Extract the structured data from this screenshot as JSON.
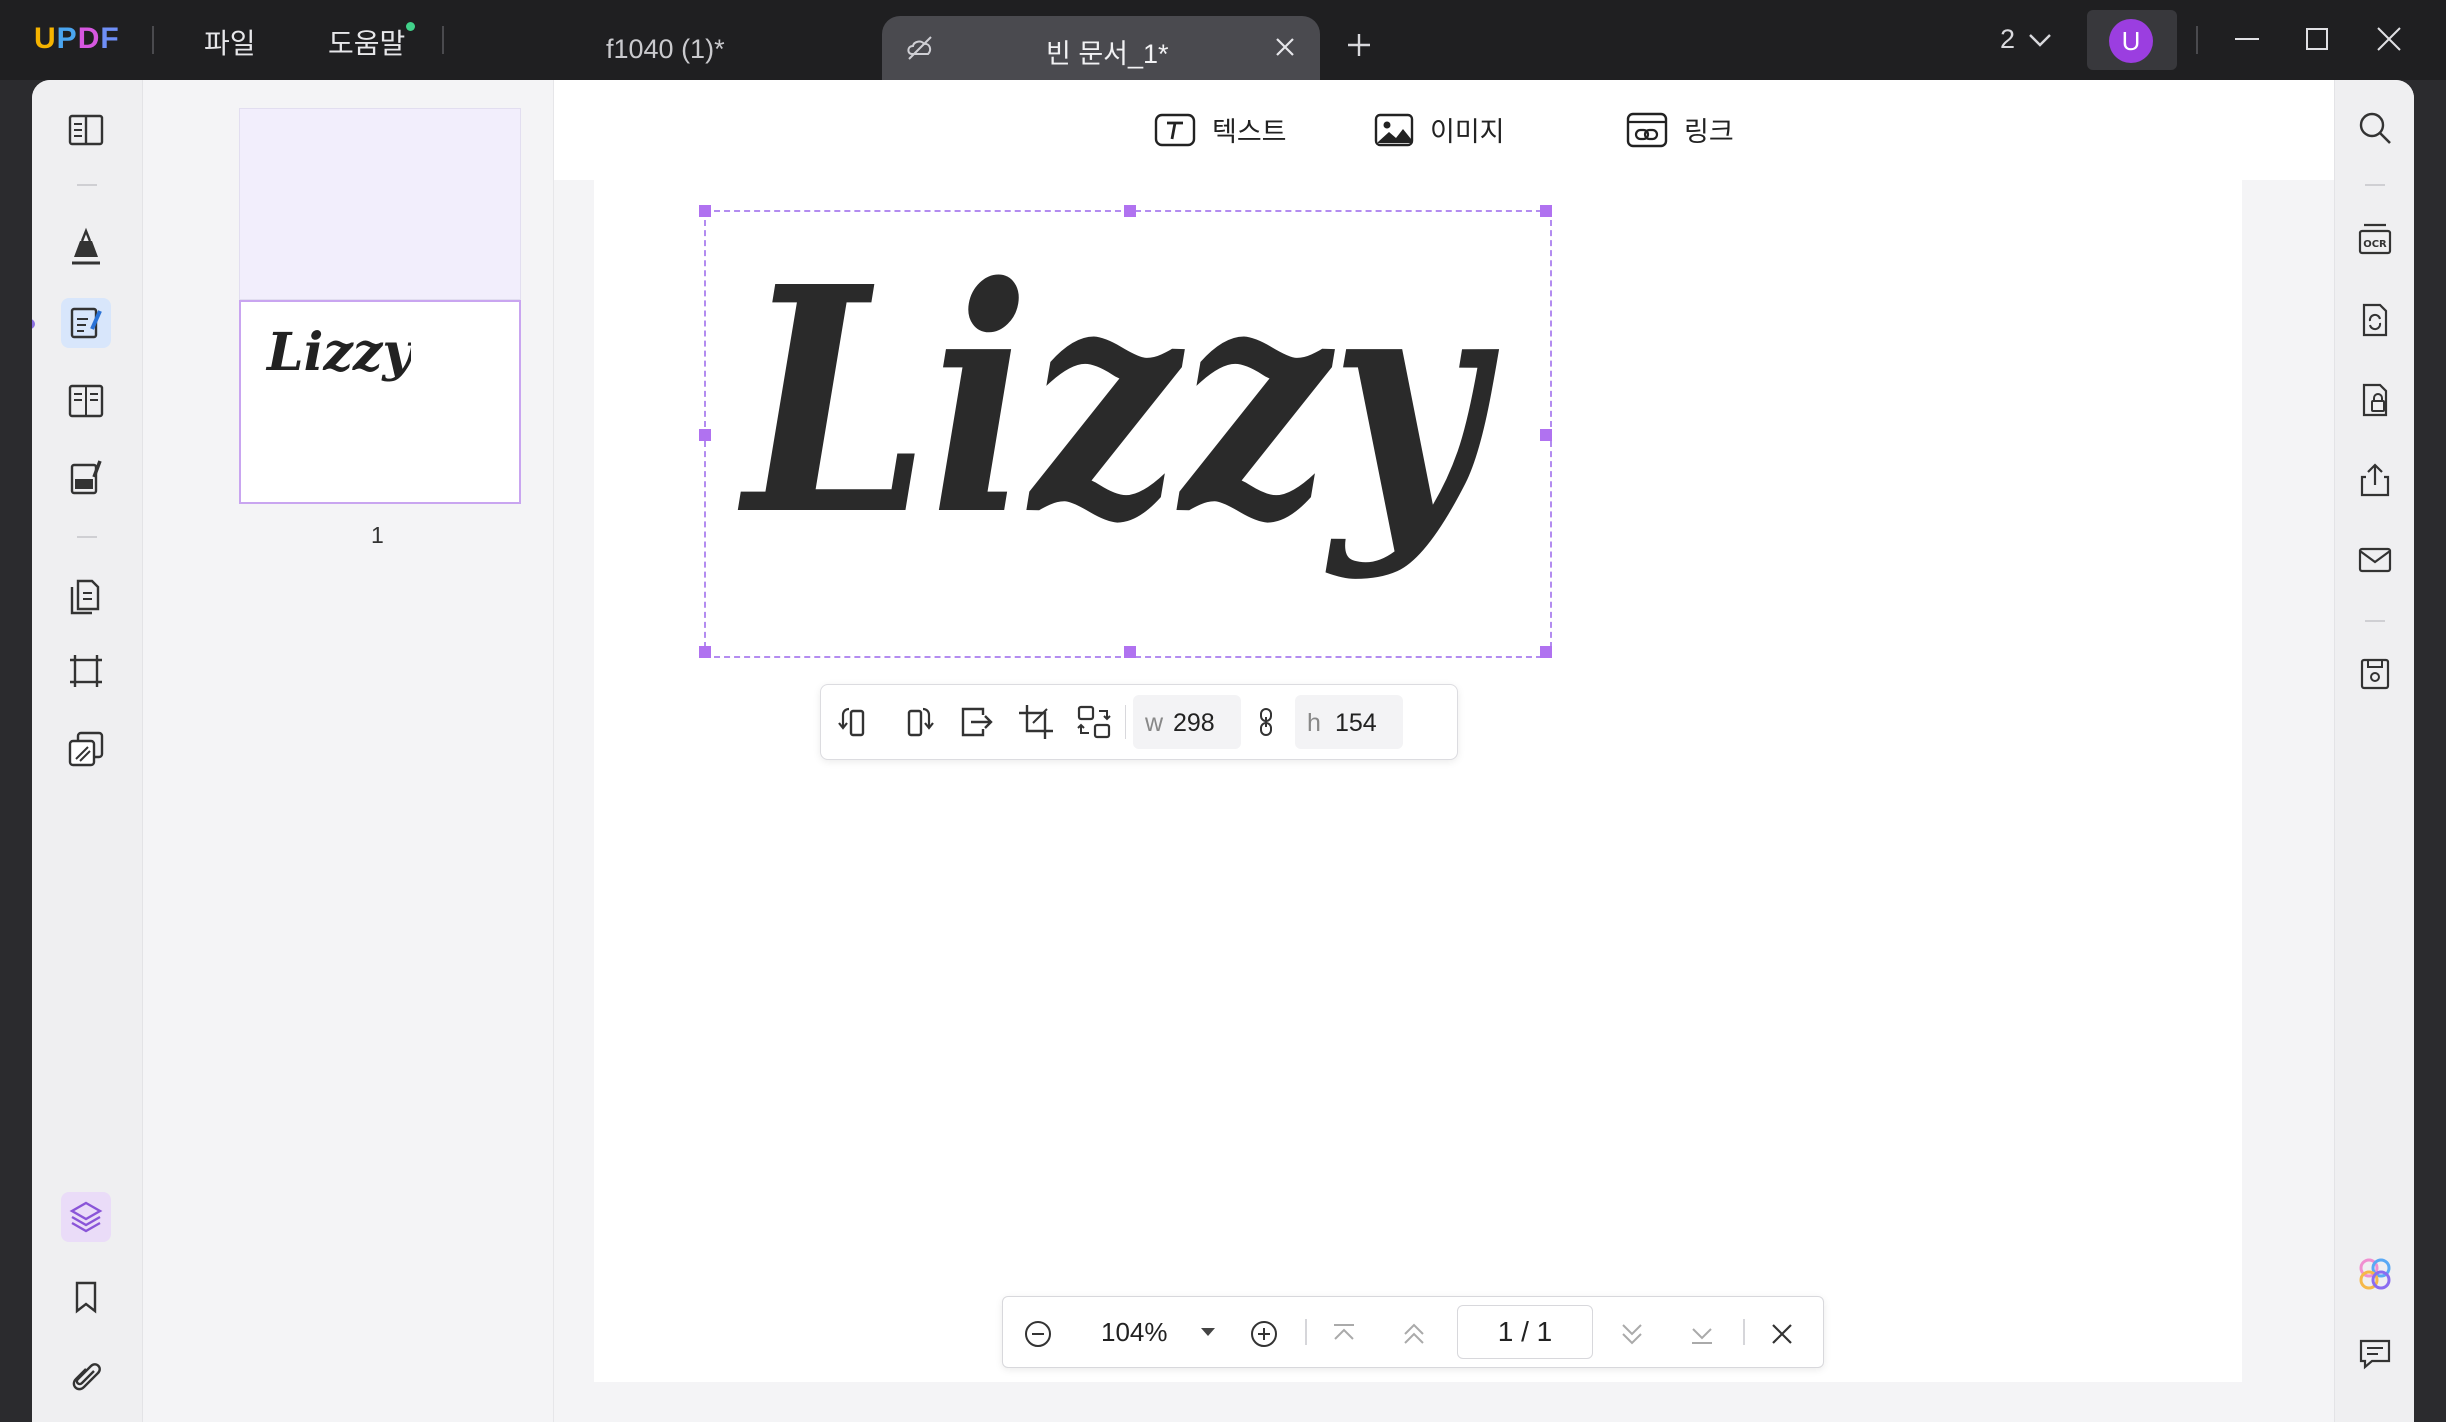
{
  "app": {
    "logo": "UPDF"
  },
  "menu": {
    "file": "파일",
    "help": "도움말"
  },
  "tabs": [
    {
      "label": "f1040 (1)*",
      "active": false
    },
    {
      "label": "빈 문서_1*",
      "active": true
    }
  ],
  "header": {
    "page_count": "2",
    "avatar_initial": "U"
  },
  "left_rail": {
    "items": [
      "reader-icon",
      "comment-icon",
      "edit-pdf-icon",
      "form-icon",
      "fill-sign-icon",
      "organize-icon",
      "crop-icon",
      "watermark-icon",
      "layers-icon",
      "bookmark-icon",
      "attachment-icon"
    ],
    "active": "edit-pdf-icon"
  },
  "thumbnails": {
    "page_number": "1",
    "preview_text": "Lizzy"
  },
  "edit_toolbar": {
    "text_label": "텍스트",
    "image_label": "이미지",
    "link_label": "링크"
  },
  "document": {
    "signature_text": "Lizzy"
  },
  "image_toolbar": {
    "width_label": "w",
    "width_value": "298",
    "height_label": "h",
    "height_value": "154"
  },
  "page_nav": {
    "zoom": "104%",
    "page_input": "1 / 1"
  },
  "right_rail": {
    "items": [
      "search-icon",
      "ocr-icon",
      "convert-icon",
      "protect-icon",
      "share-icon",
      "email-icon",
      "save-icon",
      "ai-assistant-icon",
      "chat-icon"
    ]
  },
  "colors": {
    "accent": "#b072f0",
    "titlebar": "#1f1f21",
    "avatar": "#9b3ee0"
  }
}
